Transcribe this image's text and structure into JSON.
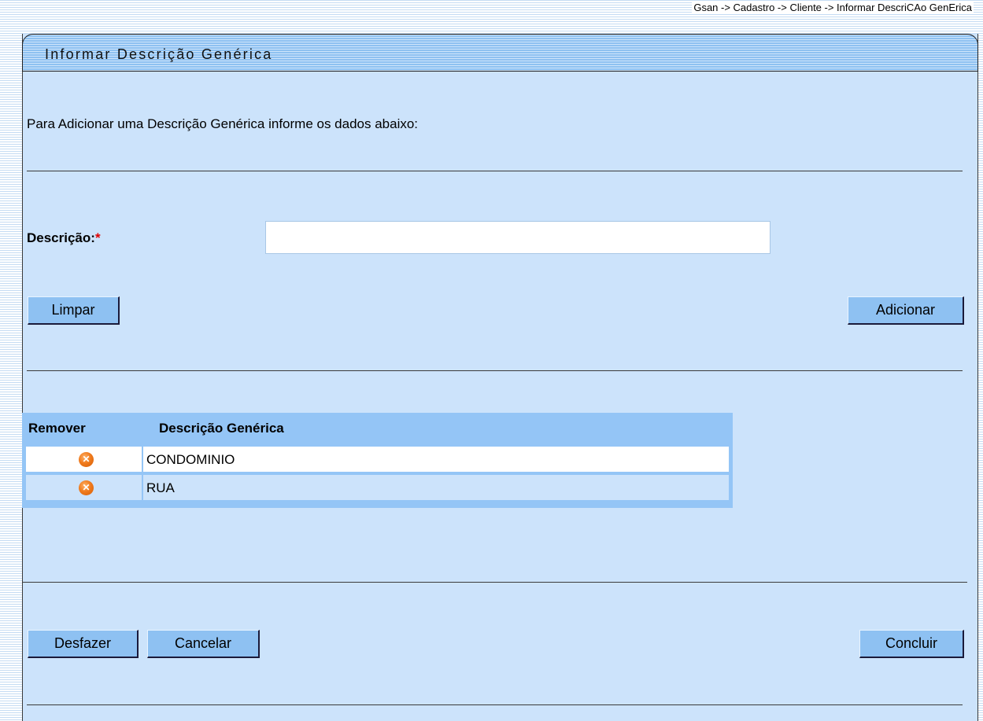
{
  "breadcrumb": "Gsan -> Cadastro -> Cliente -> Informar DescriCAo GenErica",
  "header": {
    "title": "Informar Descrição Genérica"
  },
  "intro": "Para Adicionar uma Descrição Genérica informe os dados abaixo:",
  "form": {
    "descricao_label": "Descrição:",
    "required_mark": "*",
    "descricao_value": ""
  },
  "buttons": {
    "limpar": "Limpar",
    "adicionar": "Adicionar",
    "desfazer": "Desfazer",
    "cancelar": "Cancelar",
    "concluir": "Concluir"
  },
  "table": {
    "columns": [
      "Remover",
      "Descrição Genérica"
    ],
    "rows": [
      {
        "descricao": "CONDOMINIO"
      },
      {
        "descricao": "RUA"
      }
    ]
  },
  "icons": {
    "remove": "remove-x-icon"
  },
  "colors": {
    "panel": "#cce3fb",
    "button": "#8ec1f2",
    "table_header": "#94c5f6",
    "remove_icon": "#f07b1d",
    "required": "#e00000"
  }
}
